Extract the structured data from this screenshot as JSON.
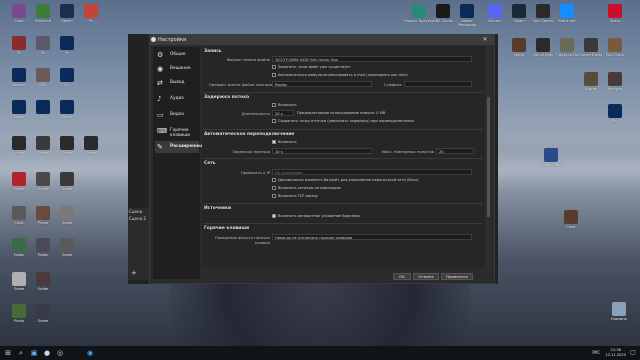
{
  "dialog": {
    "title": "Настройки",
    "close_icon": "close-icon"
  },
  "obs_main": {
    "panel_lines": [
      "Сцена",
      "Сцена 2"
    ]
  },
  "sidebar": {
    "items": [
      {
        "label": "Общие",
        "icon": "gear-icon"
      },
      {
        "label": "Вещание",
        "icon": "broadcast-icon"
      },
      {
        "label": "Вывод",
        "icon": "output-icon"
      },
      {
        "label": "Аудио",
        "icon": "speaker-icon"
      },
      {
        "label": "Видео",
        "icon": "monitor-icon"
      },
      {
        "label": "Горячие клавиши",
        "icon": "keyboard-icon"
      },
      {
        "label": "Расширенные",
        "icon": "tools-icon"
      }
    ]
  },
  "recording": {
    "heading": "Запись",
    "filename_label": "Формат имени файла",
    "filename_value": "%CCYY-%MM-%DD %hh-%mm-%ss",
    "overwrite_label": "Заменить, если файл уже существует",
    "autoremux_label": "Автоматически ремультиплексировать в mp4 (записывать как mkv)",
    "prefix_label": "Префикс имени файла повтора",
    "prefix_value": "Replay",
    "suffix_label": "Суффикс"
  },
  "stream_delay": {
    "heading": "Задержка потока",
    "enable_label": "Включить",
    "duration_label": "Длительность",
    "duration_value": "20 s",
    "duration_note": "Предполагаемое использование памяти: 0 MB",
    "preserve_label": "Сохранять точку отсечки (увеличить задержку) при переподключении"
  },
  "reconnect": {
    "heading": "Автоматическое переподключение",
    "enable_label": "Включить",
    "delay_label": "Задержка повтора",
    "delay_value": "10 s",
    "max_label": "Макс. повторных попыток",
    "max_value": "20"
  },
  "network": {
    "heading": "Сеть",
    "bind_label": "Привязать к IP",
    "bind_value": "По умолчанию",
    "dynamic_bitrate_label": "Динамически изменять битрейт для управления перегрузкой сети (Бета)",
    "new_net_label": "Включить сетевую оптимизацию",
    "tcp_label": "Включить TCP pacing"
  },
  "sources": {
    "heading": "Источники",
    "browser_accel_label": "Включить аппаратное ускорение браузера"
  },
  "hotkeys": {
    "heading": "Горячие клавиши",
    "focus_label": "Поведение фокуса горячих клавиш",
    "focus_value": "Никогда не отключать горячие клавиши"
  },
  "buttons": {
    "ok": "ОК",
    "cancel": "Отмена",
    "apply": "Применить"
  },
  "taskbar": {
    "time": "21:36",
    "date": "12.11.2020",
    "lang": "РУС"
  },
  "desktop_icons_left": [
    "Corel",
    "Minecraft",
    "Steam",
    "Ps",
    "Ps",
    "Ps",
    "Ps",
    "Discord",
    "OBS",
    "Ps",
    "Folder",
    "Ps",
    "Photo",
    "Video",
    "Folder",
    "Folder",
    "Folder",
    "Folder",
    "Game",
    "Game",
    "Corel",
    "Photo",
    "Game",
    "Folder",
    "Folder",
    "Game",
    "Game",
    "Folder",
    "Photo",
    "Game"
  ],
  "desktop_icons_top": [
    "Яндекс Браузер",
    "OBS Studio",
    "Adobe Photoshop",
    "Discord",
    "Steam",
    "Epic Games",
    "Battle.net",
    "Opera"
  ],
  "desktop_icons_right": [
    "Mafia",
    "Call of Duty",
    "7 Days to Die",
    "Conan Exiles",
    "Euro Truck",
    "Шутер",
    "Футуре",
    "Ps",
    "Glowing Blue",
    "Corel",
    "Корзина"
  ]
}
